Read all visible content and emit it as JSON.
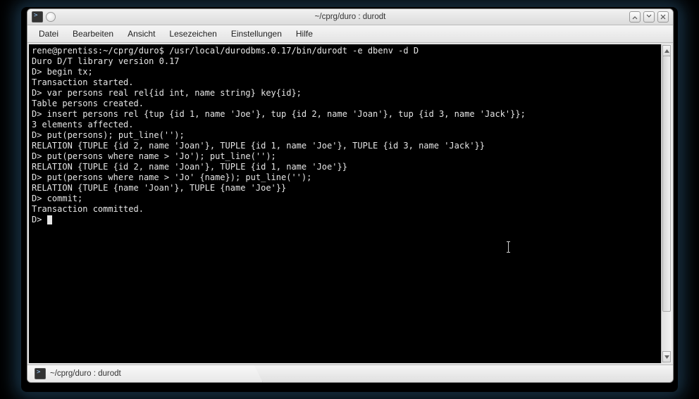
{
  "window": {
    "title": "~/cprg/duro : durodt"
  },
  "menu": {
    "items": [
      "Datei",
      "Bearbeiten",
      "Ansicht",
      "Lesezeichen",
      "Einstellungen",
      "Hilfe"
    ]
  },
  "terminal": {
    "lines": [
      "rene@prentiss:~/cprg/duro$ /usr/local/durodbms.0.17/bin/durodt -e dbenv -d D",
      "Duro D/T library version 0.17",
      "D> begin tx;",
      "Transaction started.",
      "D> var persons real rel{id int, name string} key{id};",
      "Table persons created.",
      "D> insert persons rel {tup {id 1, name 'Joe'}, tup {id 2, name 'Joan'}, tup {id 3, name 'Jack'}};",
      "3 elements affected.",
      "D> put(persons); put_line('');",
      "RELATION {TUPLE {id 2, name 'Joan'}, TUPLE {id 1, name 'Joe'}, TUPLE {id 3, name 'Jack'}}",
      "D> put(persons where name > 'Jo'); put_line('');",
      "RELATION {TUPLE {id 2, name 'Joan'}, TUPLE {id 1, name 'Joe'}}",
      "D> put(persons where name > 'Jo' {name}); put_line('');",
      "RELATION {TUPLE {name 'Joan'}, TUPLE {name 'Joe'}}",
      "D> commit;",
      "Transaction committed.",
      "D> "
    ]
  },
  "taskbar": {
    "tab_label": "~/cprg/duro : durodt"
  }
}
